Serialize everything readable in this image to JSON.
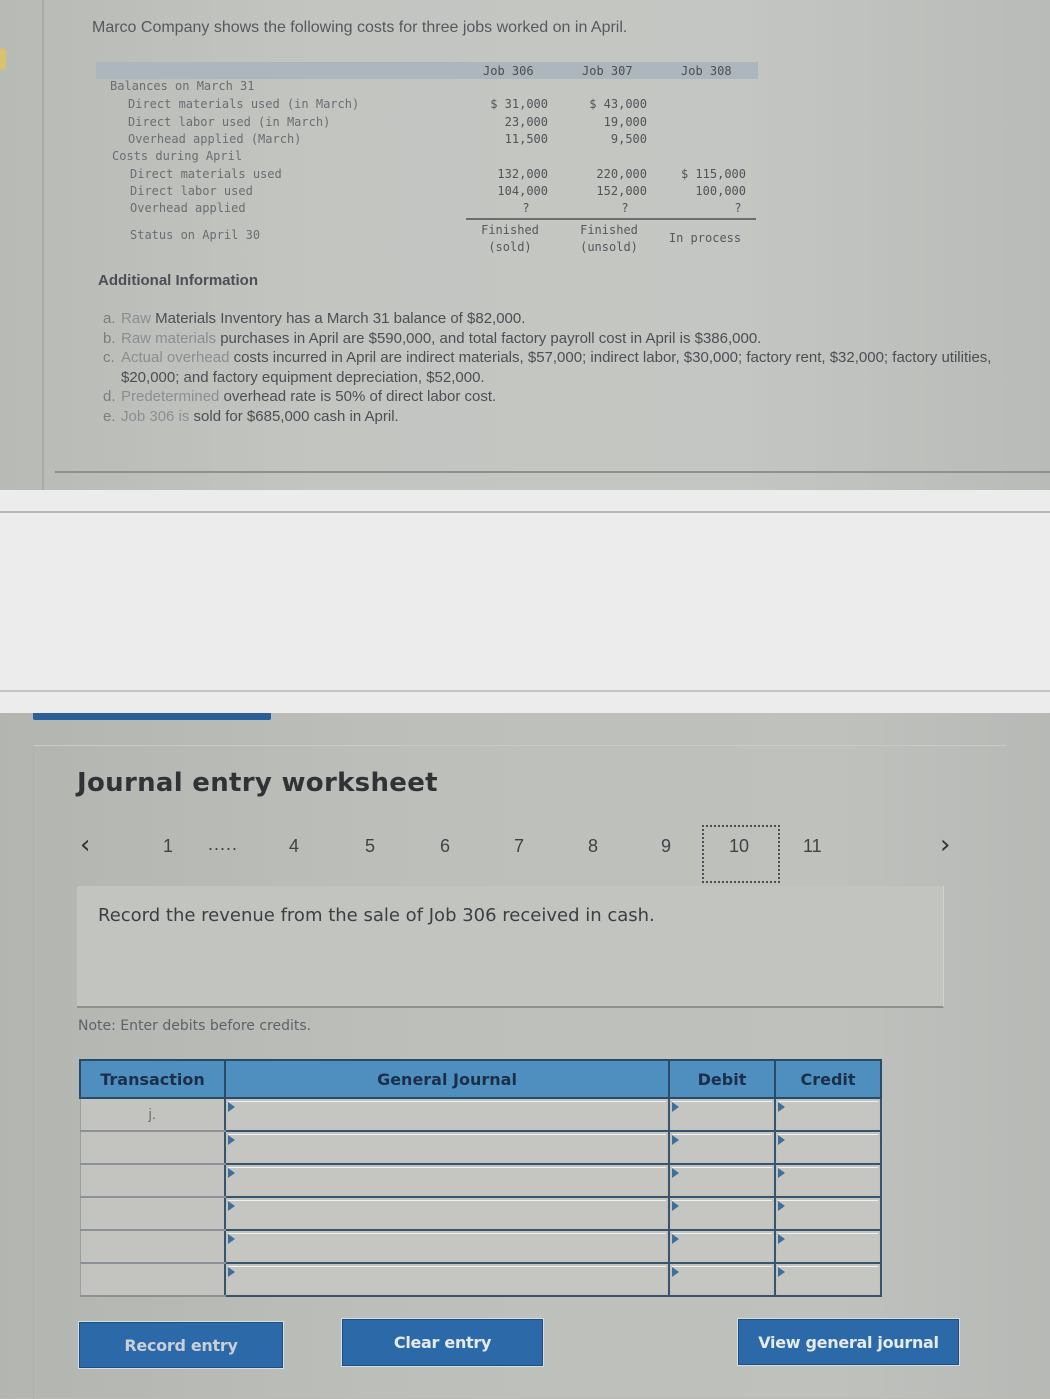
{
  "problem": {
    "intro": "Marco Company shows the following costs for three jobs worked on in April.",
    "columns": [
      "Job 306",
      "Job 307",
      "Job 308"
    ],
    "rows": [
      {
        "label": "Balances on March 31",
        "indent": 0,
        "values": [
          "",
          "",
          ""
        ]
      },
      {
        "label": "Direct materials used (in March)",
        "indent": 1,
        "values": [
          "$ 31,000",
          "$ 43,000",
          ""
        ]
      },
      {
        "label": "Direct labor used (in March)",
        "indent": 1,
        "values": [
          "23,000",
          "19,000",
          ""
        ]
      },
      {
        "label": "Overhead applied (March)",
        "indent": 1,
        "values": [
          "11,500",
          "9,500",
          ""
        ]
      },
      {
        "label": "Costs during April",
        "indent": 0,
        "values": [
          "",
          "",
          ""
        ]
      },
      {
        "label": "Direct materials used",
        "indent": 1,
        "values": [
          "132,000",
          "220,000",
          "$ 115,000"
        ]
      },
      {
        "label": "Direct labor used",
        "indent": 1,
        "values": [
          "104,000",
          "152,000",
          "100,000"
        ]
      },
      {
        "label": "Overhead applied",
        "indent": 1,
        "values": [
          "?",
          "?",
          "?"
        ]
      }
    ],
    "status_label": "Status on April 30",
    "status": [
      {
        "line1": "Finished",
        "line2": "(sold)"
      },
      {
        "line1": "Finished",
        "line2": "(unsold)"
      },
      {
        "line1": "In process",
        "line2": ""
      }
    ],
    "additional_title": "Additional Information",
    "additional": [
      {
        "letter": "a.",
        "prefix": "Raw",
        "text": " Materials Inventory has a March 31 balance of $82,000."
      },
      {
        "letter": "b.",
        "prefix": "Raw materials",
        "text": " purchases in April are $590,000, and total factory payroll cost in April is $386,000."
      },
      {
        "letter": "c.",
        "prefix": "Actual overhead",
        "text": " costs incurred in April are indirect materials, $57,000; indirect labor, $30,000; factory rent, $32,000; factory utilities, $20,000; and factory equipment depreciation, $52,000."
      },
      {
        "letter": "d.",
        "prefix": "Predetermined",
        "text": " overhead rate is 50% of direct labor cost."
      },
      {
        "letter": "e.",
        "prefix": "Job 306 is",
        "text": " sold for $685,000 cash in April."
      }
    ]
  },
  "worksheet": {
    "title": "Journal entry worksheet",
    "pager": {
      "prev_icon": "chevron-left-icon",
      "next_icon": "chevron-right-icon",
      "pages": [
        "1",
        "4",
        "5",
        "6",
        "7",
        "8",
        "9",
        "10",
        "11"
      ],
      "ellipsis": ".....",
      "current": "10"
    },
    "prompt": "Record the revenue from the sale of Job 306 received in cash.",
    "note": "Note: Enter debits before credits.",
    "table": {
      "headers": [
        "Transaction",
        "General Journal",
        "Debit",
        "Credit"
      ],
      "rows": [
        {
          "transaction": "j.",
          "account": "",
          "debit": "",
          "credit": ""
        },
        {
          "transaction": "",
          "account": "",
          "debit": "",
          "credit": ""
        },
        {
          "transaction": "",
          "account": "",
          "debit": "",
          "credit": ""
        },
        {
          "transaction": "",
          "account": "",
          "debit": "",
          "credit": ""
        },
        {
          "transaction": "",
          "account": "",
          "debit": "",
          "credit": ""
        },
        {
          "transaction": "",
          "account": "",
          "debit": "",
          "credit": ""
        }
      ]
    },
    "buttons": {
      "record": "Record entry",
      "clear": "Clear entry",
      "view": "View general journal"
    }
  },
  "colors": {
    "button_blue": "#2c69a8",
    "table_header_blue": "#4f8fbf",
    "grid_dark": "#37546d"
  }
}
